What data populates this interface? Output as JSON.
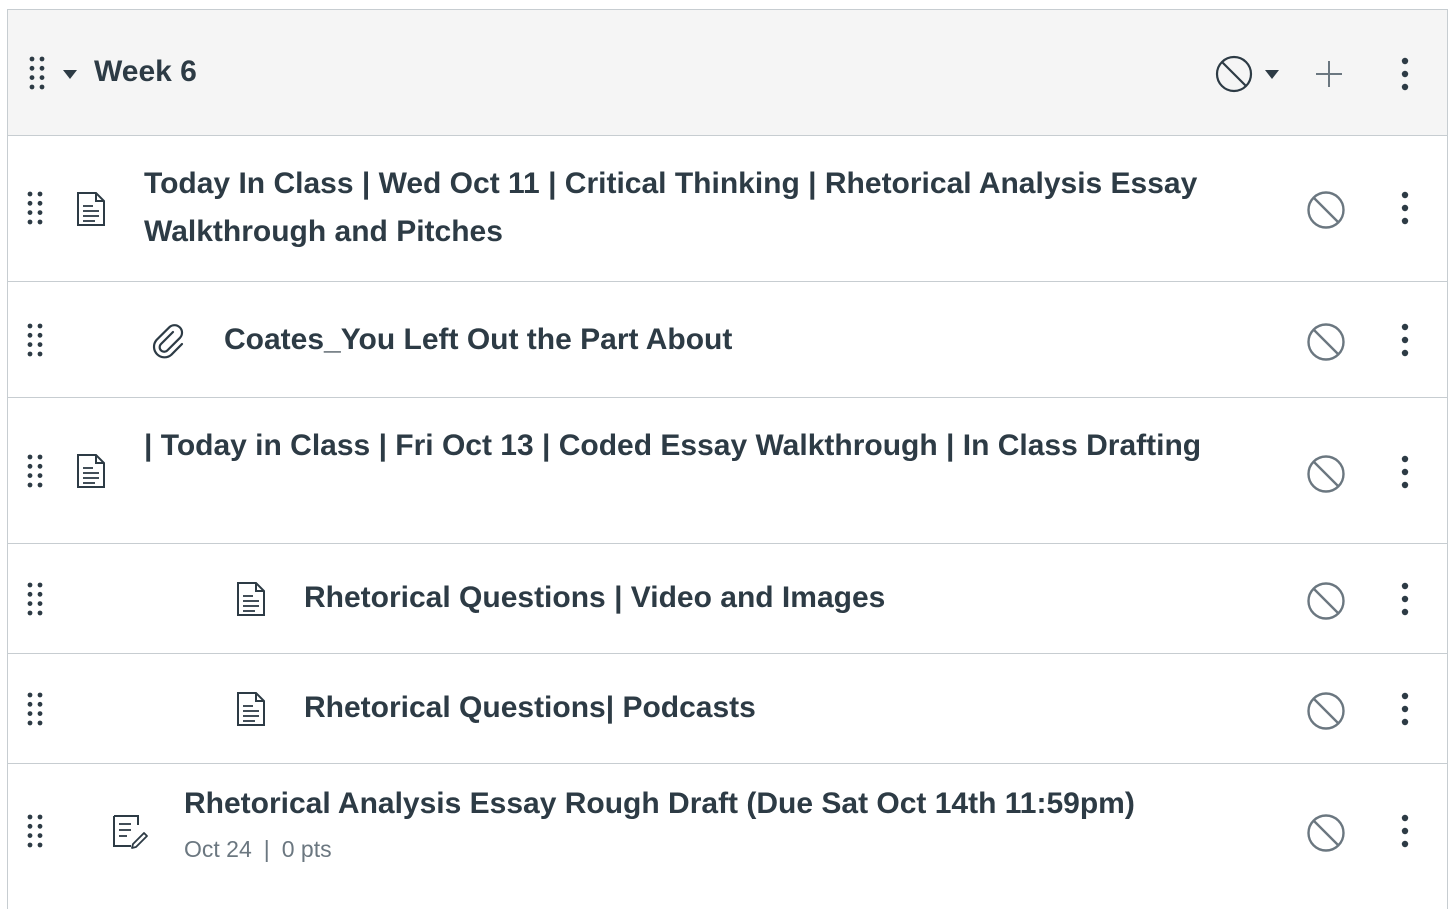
{
  "module": {
    "title": "Week 6"
  },
  "items": [
    {
      "type": "page",
      "title": "Today In Class | Wed Oct 11 | Critical Thinking | Rhetorical Analysis Essay Walkthrough and Pitches"
    },
    {
      "type": "attachment",
      "title": "Coates_You Left Out the Part About"
    },
    {
      "type": "page",
      "title": "| Today in Class | Fri Oct 13 | Coded Essay Walkthrough | In Class Drafting"
    },
    {
      "type": "page",
      "title": "Rhetorical Questions | Video and Images"
    },
    {
      "type": "page",
      "title": "Rhetorical Questions| Podcasts"
    },
    {
      "type": "assignment",
      "title": "Rhetorical Analysis Essay Rough Draft (Due Sat Oct 14th 11:59pm)",
      "due_date": "Oct 24",
      "meta_separator": "|",
      "points": "0 pts"
    }
  ],
  "icons": {
    "drag": "drag-handle-icon",
    "collapse": "caret-down-icon",
    "unpublished": "unpublished-icon",
    "add": "plus-icon",
    "menu": "kebab-menu-icon",
    "page": "document-icon",
    "attachment": "paperclip-icon",
    "assignment": "assignment-icon"
  },
  "colors": {
    "text": "#2d3b45",
    "muted": "#6b7780",
    "border": "#c7cdd1",
    "header_bg": "#f5f5f5"
  }
}
